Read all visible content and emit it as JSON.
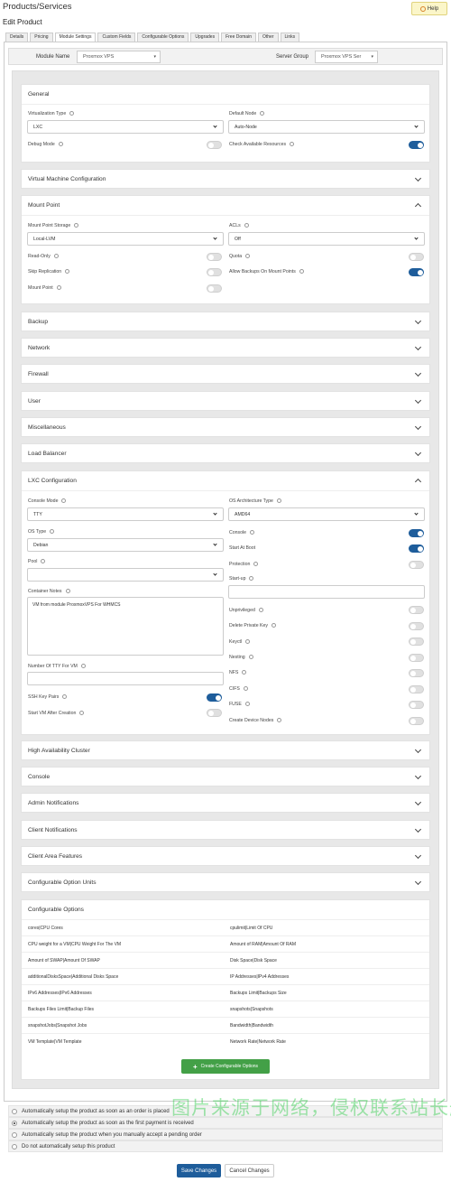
{
  "header": {
    "title": "Products/Services",
    "subtitle": "Edit Product",
    "help_label": "Help"
  },
  "tabs": [
    "Details",
    "Pricing",
    "Module Settings",
    "Custom Fields",
    "Configurable Options",
    "Upgrades",
    "Free Domain",
    "Other",
    "Links"
  ],
  "active_tab": "Module Settings",
  "module": {
    "module_name_label": "Module Name",
    "module_name_value": "Proxmox VPS",
    "server_group_label": "Server Group",
    "server_group_value": "Proxmox VPS Ser"
  },
  "general": {
    "title": "General",
    "virt_type_label": "Virtualization Type",
    "virt_type_value": "LXC",
    "default_node_label": "Default Node",
    "default_node_value": "Auto-Node",
    "debug_label": "Debug Mode",
    "check_res_label": "Check Available Resources",
    "debug_on": false,
    "check_res_on": true
  },
  "vm_config": {
    "title": "Virtual Machine Configuration"
  },
  "mount": {
    "title": "Mount Point",
    "storage_label": "Mount Point Storage",
    "storage_value": "Local-LVM",
    "acls_label": "ACLs",
    "acls_value": "Off",
    "readonly_label": "Read-Only",
    "quota_label": "Quota",
    "skip_rep_label": "Skip Replication",
    "allow_backups_label": "Allow Backups On Mount Points",
    "mountpoint_label": "Mount Point",
    "readonly_on": false,
    "quota_on": false,
    "skip_rep_on": false,
    "allow_backups_on": true,
    "mountpoint_on": false
  },
  "collapsed_a": [
    "Backup",
    "Network",
    "Firewall",
    "User",
    "Miscellaneous",
    "Load Balancer"
  ],
  "lxc": {
    "title": "LXC Configuration",
    "console_mode_label": "Console Mode",
    "console_mode_value": "TTY",
    "os_arch_label": "OS Architecture Type",
    "os_arch_value": "AMD64",
    "os_type_label": "OS Type",
    "os_type_value": "Debian",
    "console_label": "Console",
    "start_boot_label": "Start At Boot",
    "pool_label": "Pool",
    "pool_value": "",
    "protection_label": "Protection",
    "startup_label": "Start-up",
    "notes_label": "Container Notes",
    "notes_value": "VM from module ProxmoxVPS For WHMCS",
    "unprivileged_label": "Unprivileged",
    "delete_key_label": "Delete Private Key",
    "keyctl_label": "Keyctl",
    "nesting_label": "Nesting",
    "tty_label": "Number Of TTY For VM",
    "nfs_label": "NFS",
    "cifs_label": "CIFS",
    "fuse_label": "FUSE",
    "ssh_label": "SSH Key Pairs",
    "start_after_label": "Start VM After Creation",
    "create_dev_label": "Create Device Nodes",
    "console_on": true,
    "start_boot_on": true,
    "protection_on": false,
    "unprivileged_on": false,
    "delete_key_on": false,
    "keyctl_on": false,
    "nesting_on": false,
    "nfs_on": false,
    "cifs_on": false,
    "fuse_on": false,
    "ssh_on": true,
    "start_after_on": false,
    "create_dev_on": false
  },
  "collapsed_b": [
    "High Availability Cluster",
    "Console",
    "Admin Notifications",
    "Client Notifications",
    "Client Area Features",
    "Configurable Option Units"
  ],
  "config_options": {
    "title": "Configurable Options",
    "rows": [
      [
        "cores|CPU Cores",
        "cpulimit|Limit Of CPU"
      ],
      [
        "CPU weight for a VM|CPU Weight For The VM",
        "Amount of RAM|Amount Of RAM"
      ],
      [
        "Amount of SWAP|Amount Of SWAP",
        "Disk Space|Disk Space"
      ],
      [
        "additionalDisksSpace|Additional Disks Space",
        "IP Addresses|IPv4 Addresses"
      ],
      [
        "IPv6 Addresses|IPv6 Addresses",
        "Backups Limit|Backups Size"
      ],
      [
        "Backups Files Limit|Backup Files",
        "snapshots|Snapshots"
      ],
      [
        "snapshotJobs|Snapshot Jobs",
        "Bandwidth|Bandwidth"
      ],
      [
        "VM Template|VM Template",
        "Network Rate|Network Rate"
      ]
    ],
    "create_button": "Create Configurable Options"
  },
  "setup": {
    "options": [
      "Automatically setup the product as soon as an order is placed",
      "Automatically setup the product as soon as the first payment is received",
      "Automatically setup the product when you manually accept a pending order",
      "Do not automatically setup this product"
    ],
    "selected_index": 1
  },
  "watermark": "图片来源于网络，侵权联系站长删除！",
  "footer": {
    "save_label": "Save Changes",
    "cancel_label": "Cancel Changes"
  },
  "colors": {
    "toggle_on": "#1e5d9b",
    "create_button": "#43a047",
    "save_button": "#1e5d9b"
  }
}
